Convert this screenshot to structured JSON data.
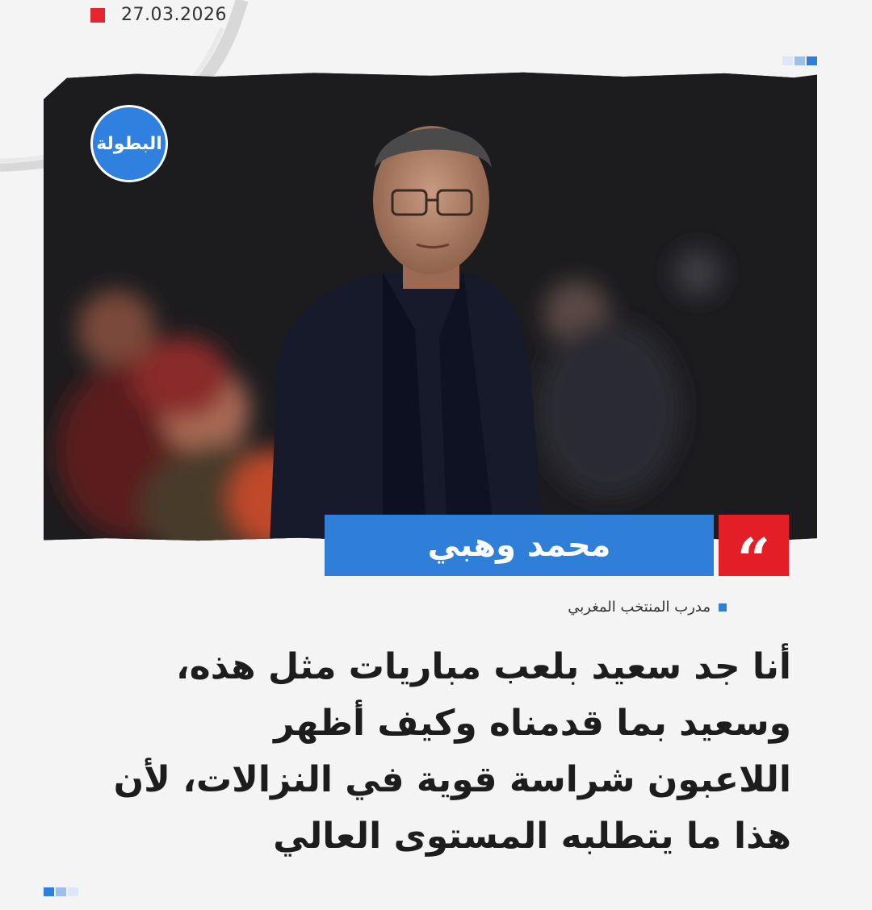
{
  "header": {
    "date": "27.03.2026"
  },
  "brand": {
    "logo_text": "البطولة",
    "accent": "#2f7fd8",
    "red": "#e31e26"
  },
  "speaker": {
    "name": "محمد وهبي",
    "role": "مدرب المنتخب المغربي"
  },
  "quote": {
    "icon": "quote-mark-icon",
    "lines": [
      "أنا جد سعيد بلعب مباريات مثل هذه،",
      "وسعيد بما قدمناه وكيف أظهر",
      "اللاعبون شراسة قوية في النزالات، لأن",
      "هذا ما يتطلبه المستوى العالي"
    ]
  }
}
